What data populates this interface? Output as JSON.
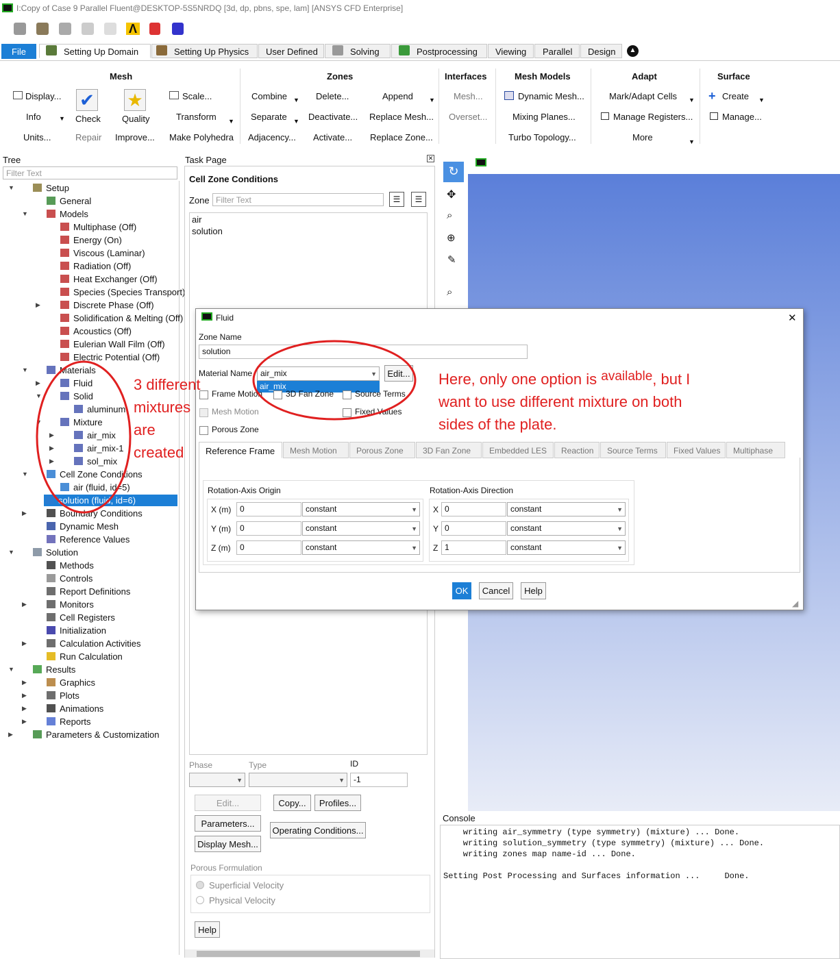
{
  "window": {
    "title": "I:Copy of Case 9 Parallel Fluent@DESKTOP-5S5NRDQ  [3d, dp, pbns, spe, lam] [ANSYS CFD Enterprise]"
  },
  "ribbon_tabs": [
    "File",
    "Setting Up Domain",
    "Setting Up Physics",
    "User Defined",
    "Solving",
    "Postprocessing",
    "Viewing",
    "Parallel",
    "Design"
  ],
  "ribbon": {
    "mesh": {
      "title": "Mesh",
      "display": "Display...",
      "info": "Info",
      "units": "Units...",
      "check": "Check",
      "repair": "Repair",
      "quality": "Quality",
      "improve": "Improve...",
      "scale": "Scale...",
      "transform": "Transform",
      "make_polyhedra": "Make Polyhedra"
    },
    "zones": {
      "title": "Zones",
      "combine": "Combine",
      "separate": "Separate",
      "adjacency": "Adjacency...",
      "delete": "Delete...",
      "deactivate": "Deactivate...",
      "activate": "Activate...",
      "append": "Append",
      "replace_mesh": "Replace Mesh...",
      "replace_zone": "Replace Zone..."
    },
    "interfaces": {
      "title": "Interfaces",
      "mesh": "Mesh...",
      "overset": "Overset..."
    },
    "mesh_models": {
      "title": "Mesh Models",
      "dynamic_mesh": "Dynamic Mesh...",
      "mixing_planes": "Mixing Planes...",
      "turbo_topology": "Turbo Topology..."
    },
    "adapt": {
      "title": "Adapt",
      "mark_adapt": "Mark/Adapt Cells",
      "manage_registers": "Manage Registers...",
      "more": "More"
    },
    "surface": {
      "title": "Surface",
      "create": "Create",
      "manage": "Manage..."
    }
  },
  "tree": {
    "title": "Tree",
    "filter_placeholder": "Filter Text",
    "items": [
      {
        "label": "Setup",
        "level": 0,
        "exp": "open",
        "icon": "setup"
      },
      {
        "label": "General",
        "level": 1,
        "exp": "",
        "icon": "general"
      },
      {
        "label": "Models",
        "level": 1,
        "exp": "open",
        "icon": "model"
      },
      {
        "label": "Multiphase (Off)",
        "level": 2,
        "exp": "",
        "icon": "model"
      },
      {
        "label": "Energy (On)",
        "level": 2,
        "exp": "",
        "icon": "model"
      },
      {
        "label": "Viscous (Laminar)",
        "level": 2,
        "exp": "",
        "icon": "model"
      },
      {
        "label": "Radiation (Off)",
        "level": 2,
        "exp": "",
        "icon": "model"
      },
      {
        "label": "Heat Exchanger (Off)",
        "level": 2,
        "exp": "",
        "icon": "model"
      },
      {
        "label": "Species (Species Transport)",
        "level": 2,
        "exp": "",
        "icon": "model"
      },
      {
        "label": "Discrete Phase (Off)",
        "level": 2,
        "exp": "closed",
        "icon": "model"
      },
      {
        "label": "Solidification & Melting (Off)",
        "level": 2,
        "exp": "",
        "icon": "model"
      },
      {
        "label": "Acoustics (Off)",
        "level": 2,
        "exp": "",
        "icon": "model"
      },
      {
        "label": "Eulerian Wall Film (Off)",
        "level": 2,
        "exp": "",
        "icon": "model"
      },
      {
        "label": "Electric Potential (Off)",
        "level": 2,
        "exp": "",
        "icon": "model"
      },
      {
        "label": "Materials",
        "level": 1,
        "exp": "open",
        "icon": "flask"
      },
      {
        "label": "Fluid",
        "level": 2,
        "exp": "closed",
        "icon": "flask"
      },
      {
        "label": "Solid",
        "level": 2,
        "exp": "open",
        "icon": "flask"
      },
      {
        "label": "aluminum",
        "level": 3,
        "exp": "",
        "icon": "flask"
      },
      {
        "label": "Mixture",
        "level": 2,
        "exp": "open",
        "icon": "flask"
      },
      {
        "label": "air_mix",
        "level": 3,
        "exp": "closed",
        "icon": "flask"
      },
      {
        "label": "air_mix-1",
        "level": 3,
        "exp": "closed",
        "icon": "flask"
      },
      {
        "label": "sol_mix",
        "level": 3,
        "exp": "closed",
        "icon": "flask"
      },
      {
        "label": "Cell Zone Conditions",
        "level": 1,
        "exp": "open",
        "icon": "zone"
      },
      {
        "label": "air (fluid, id=5)",
        "level": 2,
        "exp": "",
        "icon": "zone"
      },
      {
        "label": "solution (fluid, id=6)",
        "level": 2,
        "exp": "",
        "icon": "zone",
        "selected": true
      },
      {
        "label": "Boundary Conditions",
        "level": 1,
        "exp": "closed",
        "icon": "bc"
      },
      {
        "label": "Dynamic Mesh",
        "level": 1,
        "exp": "",
        "icon": "dyn"
      },
      {
        "label": "Reference Values",
        "level": 1,
        "exp": "",
        "icon": "ref"
      },
      {
        "label": "Solution",
        "level": 0,
        "exp": "open",
        "icon": "solution"
      },
      {
        "label": "Methods",
        "level": 1,
        "exp": "",
        "icon": "methods"
      },
      {
        "label": "Controls",
        "level": 1,
        "exp": "",
        "icon": "controls"
      },
      {
        "label": "Report Definitions",
        "level": 1,
        "exp": "",
        "icon": "report"
      },
      {
        "label": "Monitors",
        "level": 1,
        "exp": "closed",
        "icon": "report"
      },
      {
        "label": "Cell Registers",
        "level": 1,
        "exp": "",
        "icon": "report"
      },
      {
        "label": "Initialization",
        "level": 1,
        "exp": "",
        "icon": "init"
      },
      {
        "label": "Calculation Activities",
        "level": 1,
        "exp": "closed",
        "icon": "report"
      },
      {
        "label": "Run Calculation",
        "level": 1,
        "exp": "",
        "icon": "run"
      },
      {
        "label": "Results",
        "level": 0,
        "exp": "open",
        "icon": "results"
      },
      {
        "label": "Graphics",
        "level": 1,
        "exp": "closed",
        "icon": "graphics"
      },
      {
        "label": "Plots",
        "level": 1,
        "exp": "closed",
        "icon": "plots"
      },
      {
        "label": "Animations",
        "level": 1,
        "exp": "closed",
        "icon": "anim"
      },
      {
        "label": "Reports",
        "level": 1,
        "exp": "closed",
        "icon": "reports"
      },
      {
        "label": "Parameters & Customization",
        "level": 0,
        "exp": "closed",
        "icon": "params"
      }
    ]
  },
  "task_page": {
    "title": "Task Page",
    "heading": "Cell Zone Conditions",
    "zone_label": "Zone",
    "filter_placeholder": "Filter Text",
    "zones": [
      "air",
      "solution"
    ],
    "phase_label": "Phase",
    "type_label": "Type",
    "id_label": "ID",
    "id_value": "-1",
    "edit": "Edit...",
    "copy": "Copy...",
    "profiles": "Profiles...",
    "parameters": "Parameters...",
    "operating_conditions": "Operating Conditions...",
    "display_mesh": "Display Mesh...",
    "porous_formulation": "Porous Formulation",
    "superficial": "Superficial Velocity",
    "physical": "Physical Velocity",
    "help": "Help"
  },
  "dialog": {
    "title": "Fluid",
    "zone_name_label": "Zone Name",
    "zone_name": "solution",
    "material_label": "Material Name",
    "material_value": "air_mix",
    "dropdown_option": "air_mix",
    "edit": "Edit...",
    "frame_motion": "Frame Motion",
    "fan_zone": "3D Fan Zone",
    "source_terms": "Source Terms",
    "mesh_motion": "Mesh Motion",
    "fixed_values": "Fixed Values",
    "porous_zone": "Porous Zone",
    "tabs": [
      "Reference Frame",
      "Mesh Motion",
      "Porous Zone",
      "3D Fan Zone",
      "Embedded LES",
      "Reaction",
      "Source Terms",
      "Fixed Values",
      "Multiphase"
    ],
    "origin_title": "Rotation-Axis Origin",
    "direction_title": "Rotation-Axis Direction",
    "origin": [
      {
        "label": "X (m)",
        "value": "0",
        "method": "constant"
      },
      {
        "label": "Y (m)",
        "value": "0",
        "method": "constant"
      },
      {
        "label": "Z (m)",
        "value": "0",
        "method": "constant"
      }
    ],
    "direction": [
      {
        "label": "X",
        "value": "0",
        "method": "constant"
      },
      {
        "label": "Y",
        "value": "0",
        "method": "constant"
      },
      {
        "label": "Z",
        "value": "1",
        "method": "constant"
      }
    ],
    "ok": "OK",
    "cancel": "Cancel",
    "help": "Help"
  },
  "console": {
    "title": "Console",
    "lines": [
      "    writing air_symmetry (type symmetry) (mixture) ... Done.",
      "    writing solution_symmetry (type symmetry) (mixture) ... Done.",
      "    writing zones map name-id ... Done.",
      "",
      "Setting Post Processing and Surfaces information ...     Done."
    ]
  },
  "annotations": {
    "left": [
      "3 different",
      "mixtures",
      "are",
      "created"
    ],
    "right_1a": "Here, only one option is ",
    "right_1b": "available",
    "right_1c": ", but I",
    "right_2": "want to use different mixture on both",
    "right_3": "sides of the plate."
  },
  "colors": {
    "accent": "#1c7fd6",
    "annotation": "#e02020",
    "viewport_top": "#5b7fd9",
    "viewport_bottom": "#e8ecf7"
  }
}
